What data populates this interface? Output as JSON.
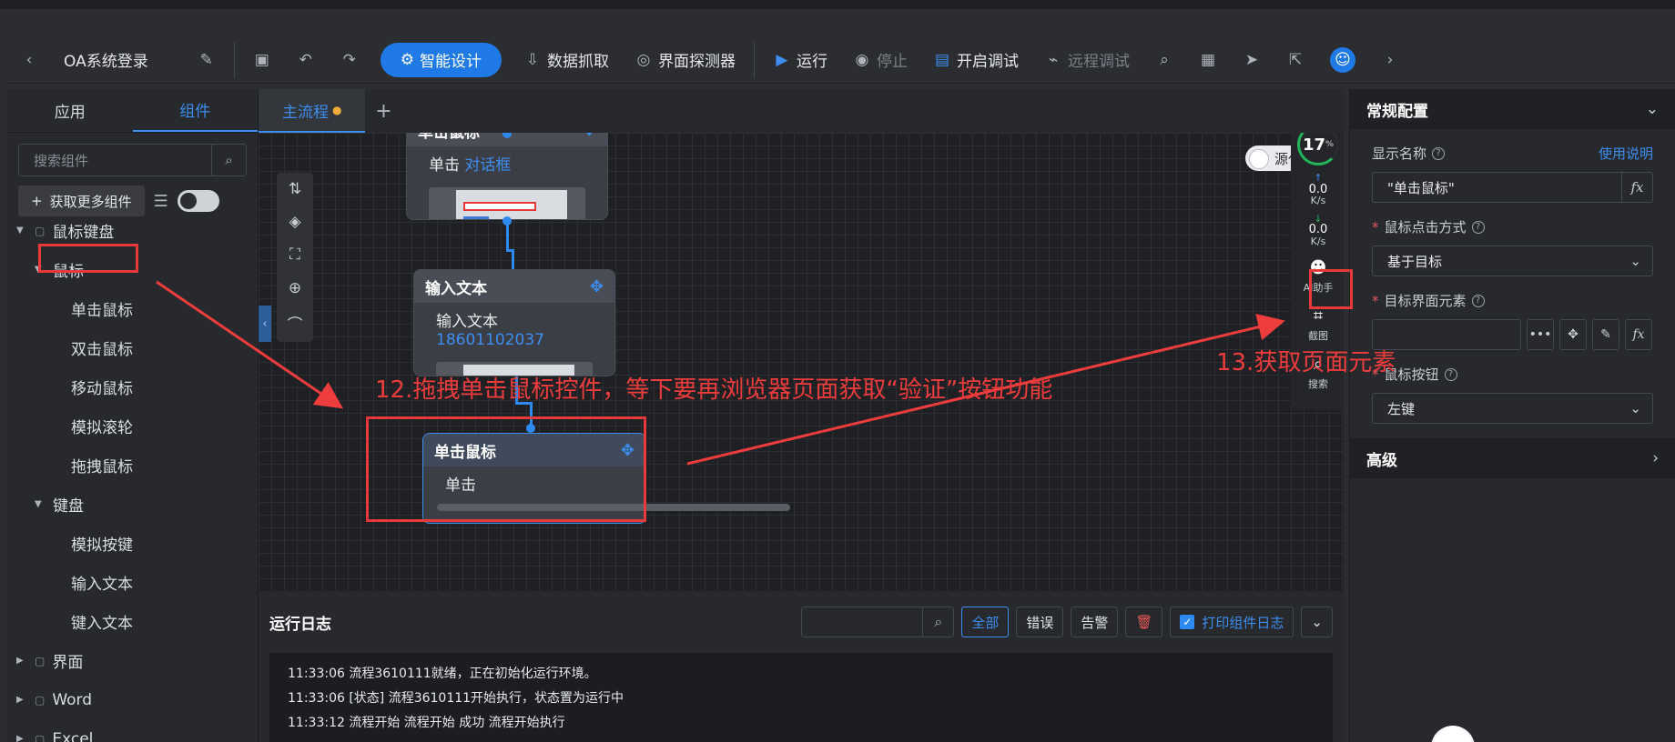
{
  "toolbar": {
    "title": "OA系统登录",
    "smart": "智能设计",
    "scrape": "数据抓取",
    "detector": "界面探测器",
    "run": "运行",
    "stop": "停止",
    "debug": "开启调试",
    "remote": "远程调试"
  },
  "left": {
    "tab_app": "应用",
    "tab_comp": "组件",
    "search_placeholder": "搜索组件",
    "more": "获取更多组件",
    "tree": [
      {
        "label": "鼠标键盘",
        "level": 0
      },
      {
        "label": "鼠标",
        "level": 1
      },
      {
        "label": "单击鼠标",
        "level": 2
      },
      {
        "label": "双击鼠标",
        "level": 2
      },
      {
        "label": "移动鼠标",
        "level": 2
      },
      {
        "label": "模拟滚轮",
        "level": 2
      },
      {
        "label": "拖拽鼠标",
        "level": 2
      },
      {
        "label": "键盘",
        "level": 1
      },
      {
        "label": "模拟按键",
        "level": 2
      },
      {
        "label": "输入文本",
        "level": 2
      },
      {
        "label": "键入文本",
        "level": 2
      },
      {
        "label": "界面",
        "level": 0
      },
      {
        "label": "Word",
        "level": 0
      },
      {
        "label": "Excel",
        "level": 0
      }
    ]
  },
  "canvas": {
    "tab": "主流程",
    "source_toggle": "源代",
    "node1": {
      "title": "单击鼠标",
      "action": "单击",
      "target": "对话框"
    },
    "node2": {
      "title": "输入文本",
      "action": "输入文本",
      "value": "18601102037"
    },
    "node3": {
      "title": "单击鼠标",
      "action": "单击"
    }
  },
  "monitor": {
    "percent": "17",
    "pct_sign": "%",
    "up": "0.0",
    "down": "0.0",
    "unit": "K/s",
    "ai": "AI助手",
    "crop": "截图",
    "search": "搜索"
  },
  "log": {
    "title": "运行日志",
    "all": "全部",
    "error": "错误",
    "warn": "告警",
    "print": "打印组件日志",
    "lines": [
      "11:33:06 流程3610111就绪，正在初始化运行环境。",
      "11:33:06 [状态] 流程3610111开始执行，状态置为运行中",
      "11:33:12 流程开始 流程开始 成功 流程开始执行"
    ]
  },
  "right": {
    "section1": "常规配置",
    "display_name_label": "显示名称",
    "help_link": "使用说明",
    "display_name_value": "\"单击鼠标\"",
    "click_mode_label": "鼠标点击方式",
    "click_mode_value": "基于目标",
    "target_label": "目标界面元素",
    "button_label": "鼠标按钮",
    "button_value": "左键",
    "section2": "高级"
  },
  "annotations": {
    "a12": "12.拖拽单击鼠标控件，等下要再浏览器页面获取“验证”按钮功能",
    "a13": "13.获取页面元素"
  }
}
